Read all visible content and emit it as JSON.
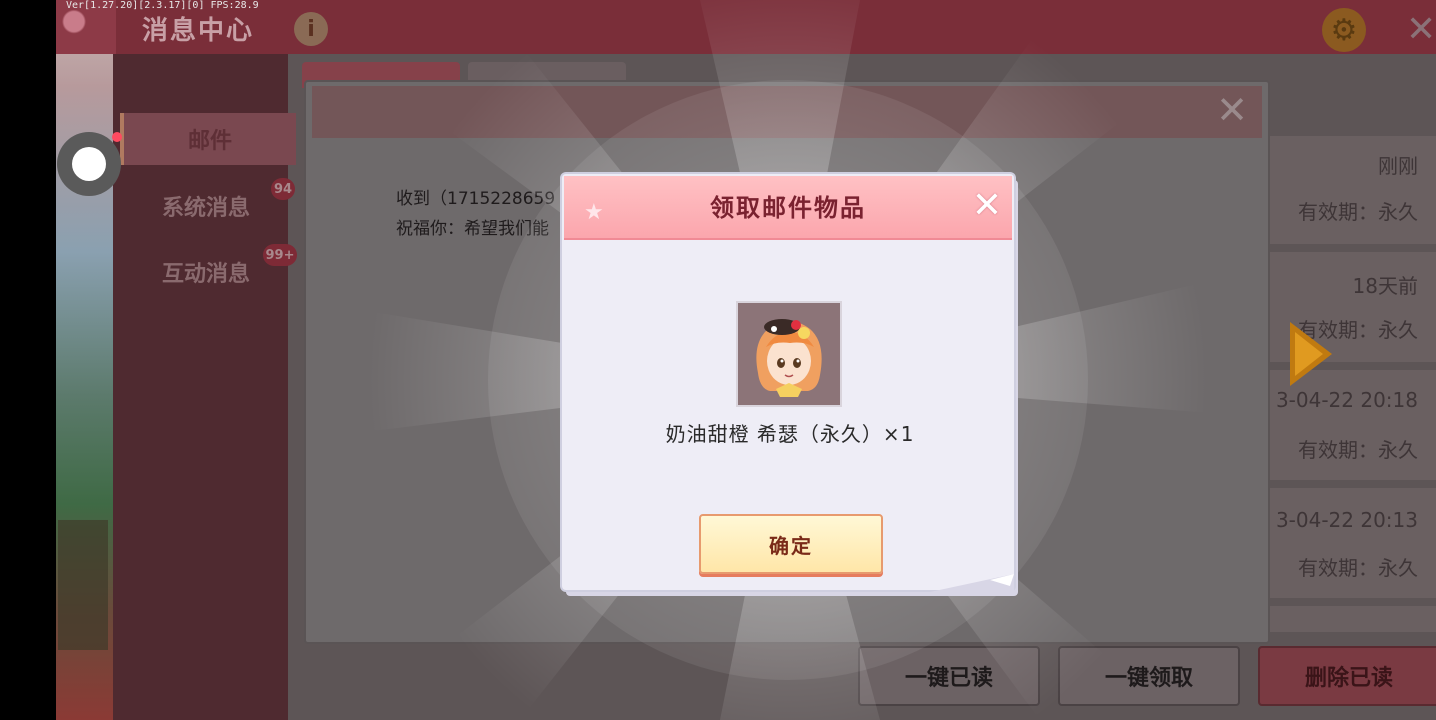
{
  "debug_text": "Ver[1.27.20][2.3.17][0] FPS:28.9",
  "header": {
    "title": "消息中心",
    "info_icon": "i"
  },
  "sidebar": {
    "items": [
      {
        "label": "邮件"
      },
      {
        "label": "系统消息",
        "badge": "94"
      },
      {
        "label": "互动消息",
        "badge": "99+"
      }
    ]
  },
  "mail": {
    "line1": "收到（1715228659",
    "line2": "祝福你：希望我们能"
  },
  "list": {
    "rows": [
      {
        "time": "刚刚",
        "valid": "有效期：永久"
      },
      {
        "time": "18天前",
        "valid": "有效期：永久"
      },
      {
        "time": "3-04-22 20:18",
        "valid": "有效期：永久"
      },
      {
        "time": "3-04-22 20:13",
        "valid": "有效期：永久"
      }
    ]
  },
  "footer": {
    "mark_read": "一键已读",
    "claim_all": "一键领取",
    "delete_read": "删除已读"
  },
  "dialog": {
    "title": "领取邮件物品",
    "item_name": "奶油甜橙 希瑟（永久）×1",
    "confirm": "确定"
  },
  "icons": {
    "close": "close-icon",
    "gear": "gear-icon",
    "info": "info-icon",
    "arrow": "arrow-right-icon"
  },
  "colors": {
    "dialog_header": "#fba6ad",
    "confirm_button": "#ffe6a8",
    "arrow": "#c07a10"
  }
}
